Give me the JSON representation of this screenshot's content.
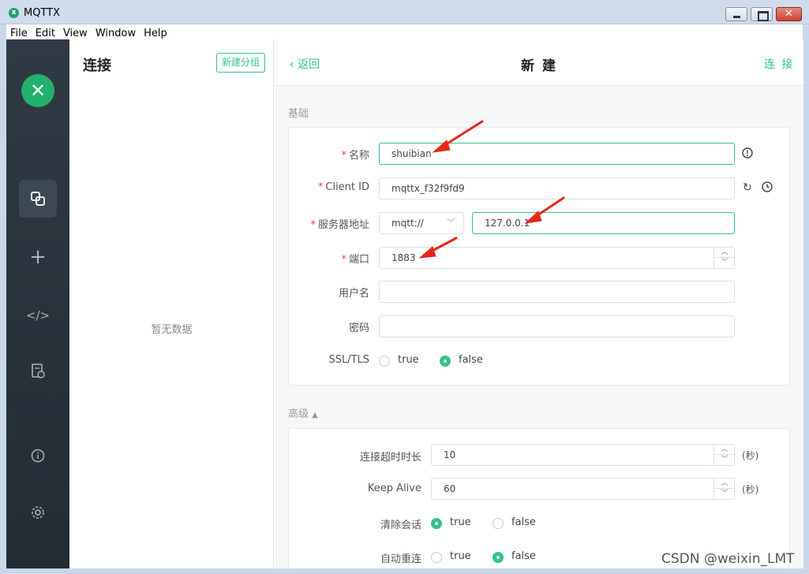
{
  "window": {
    "title": "MQTTX"
  },
  "menu": [
    "File",
    "Edit",
    "View",
    "Window",
    "Help"
  ],
  "sidebar": {
    "logo_glyph": "✕",
    "nav_icons": [
      "connections-icon",
      "add-icon",
      "script-icon",
      "log-icon",
      "about-icon",
      "settings-icon"
    ]
  },
  "connections": {
    "title": "连接",
    "new_group_label": "新建分组",
    "empty_text": "暂无数据"
  },
  "header": {
    "back_label": "返回",
    "title": "新 建",
    "connect_label": "连 接"
  },
  "basic": {
    "section_title": "基础",
    "name_label": "名称",
    "name_value": "shuibian",
    "client_id_label": "Client ID",
    "client_id_value": "mqttx_f32f9fd9",
    "host_label": "服务器地址",
    "protocol_value": "mqtt://",
    "host_value": "127.0.0.1",
    "port_label": "端口",
    "port_value": "1883",
    "username_label": "用户名",
    "username_value": "",
    "password_label": "密码",
    "password_value": "",
    "ssl_label": "SSL/TLS",
    "true_label": "true",
    "false_label": "false",
    "ssl_selected": "false"
  },
  "advanced": {
    "section_title": "高级",
    "timeout_label": "连接超时时长",
    "timeout_value": "10",
    "timeout_unit": "(秒)",
    "keepalive_label": "Keep Alive",
    "keepalive_value": "60",
    "keepalive_unit": "(秒)",
    "clean_label": "清除会话",
    "clean_selected": "true",
    "reconnect_label": "自动重连",
    "reconnect_selected": "false",
    "true_label": "true",
    "false_label": "false"
  },
  "watermark": "CSDN @weixin_LMT",
  "colors": {
    "accent": "#34c388",
    "sidebar": "#2b353f",
    "required": "#e2483d"
  }
}
